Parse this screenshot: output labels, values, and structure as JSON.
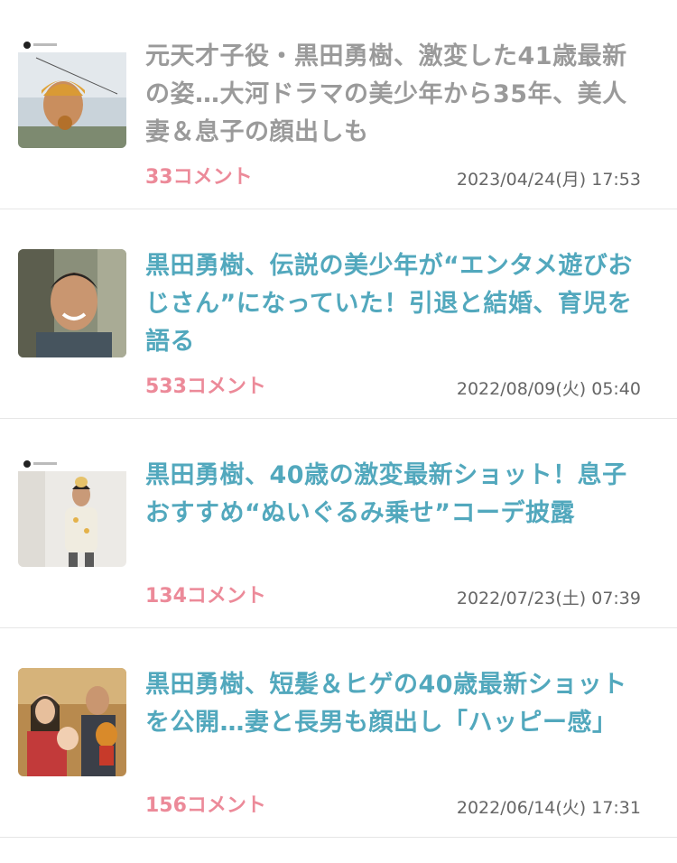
{
  "articles": [
    {
      "title": "元天才子役・黒田勇樹、激変した41歳最新の姿…大河ドラマの美少年から35年、美人妻＆息子の顔出しも",
      "comments": "33コメント",
      "date": "2023/04/24(月) 17:53",
      "visited": true,
      "thumbnail": "instagram-post-man-eating-outdoors"
    },
    {
      "title": "黒田勇樹、伝説の美少年が“エンタメ遊びおじさん”になっていた！引退と結婚、育児を語る",
      "comments": "533コメント",
      "date": "2022/08/09(火) 05:40",
      "visited": false,
      "thumbnail": "smiling-man-portrait"
    },
    {
      "title": "黒田勇樹、40歳の激変最新ショット！息子おすすめ“ぬいぐるみ乗せ”コーデ披露",
      "comments": "134コメント",
      "date": "2022/07/23(土) 07:39",
      "visited": false,
      "thumbnail": "instagram-post-man-with-plush"
    },
    {
      "title": "黒田勇樹、短髪＆ヒゲの40歳最新ショットを公開…妻と長男も顔出し「ハッピー感」",
      "comments": "156コメント",
      "date": "2022/06/14(火) 17:31",
      "visited": false,
      "thumbnail": "family-photo"
    }
  ]
}
